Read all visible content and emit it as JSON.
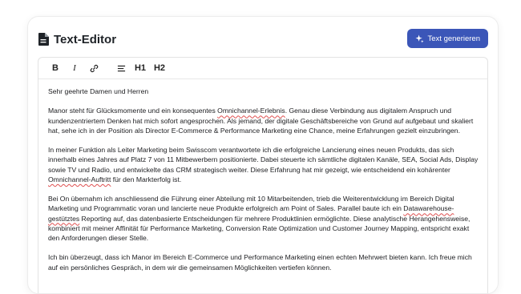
{
  "header": {
    "title": "Text-Editor",
    "title_icon": "document-icon",
    "generate_button": {
      "label": "Text generieren",
      "icon": "sparkle-icon"
    }
  },
  "toolbar": {
    "bold": "B",
    "italic": "I",
    "link_icon": "link-icon",
    "list_icon": "list-icon",
    "h1": "H1",
    "h2": "H2"
  },
  "letter": {
    "greeting": "Sehr geehrte Damen und Herren",
    "p1": {
      "a": "Manor steht für Glücksmomente und ein konsequentes ",
      "b": "Omnichannel-Erlebnis",
      "c": ". Genau diese Verbindung aus digitalem Anspruch und kundenzentriertem Denken hat mich sofort angesprochen. Als jemand, der digitale Geschäftsbereiche von Grund auf aufgebaut und skaliert hat, sehe ich in der Position als Director E-Commerce & Performance Marketing eine Chance, meine Erfahrungen gezielt einzubringen."
    },
    "p2": {
      "a": "In meiner Funktion als Leiter Marketing beim Swisscom verantwortete ich die erfolgreiche Lancierung eines neuen Produkts, das sich innerhalb eines Jahres auf Platz 7 von 11 Mitbewerbern positionierte. Dabei steuerte ich sämtliche digitalen Kanäle, SEA, Social Ads, Display sowie TV und Radio, und entwickelte das CRM strategisch weiter. Diese Erfahrung hat mir gezeigt, wie entscheidend ein kohärenter ",
      "b": "Omnichannel-Auftritt",
      "c": " für den Markterfolg ist."
    },
    "p3": {
      "a": "Bei On übernahm ich anschliessend die Führung einer Abteilung mit 10 Mitarbeitenden, trieb die Weiterentwicklung im Bereich Digital Marketing und Programmatic voran und lancierte neue Produkte erfolgreich am Point of Sales. Parallel baute ich ein ",
      "b": "Datawarehouse-gestütztes",
      "c": " Reporting auf, das datenbasierte Entscheidungen für mehrere Produktlinien ermöglichte. Diese analytische Herangehensweise, kombiniert mit meiner Affinität für Performance Marketing, Conversion Rate Optimization und Customer Journey Mapping, entspricht exakt den Anforderungen dieser Stelle."
    },
    "p4": "Ich bin überzeugt, dass ich Manor im Bereich E-Commerce und Performance Marketing einen echten Mehrwert bieten kann. Ich freue mich auf ein persönliches Gespräch, in dem wir die gemeinsamen Möglichkeiten vertiefen können."
  },
  "colors": {
    "accent": "#3b56b8",
    "spellcheck": "#e05050"
  }
}
